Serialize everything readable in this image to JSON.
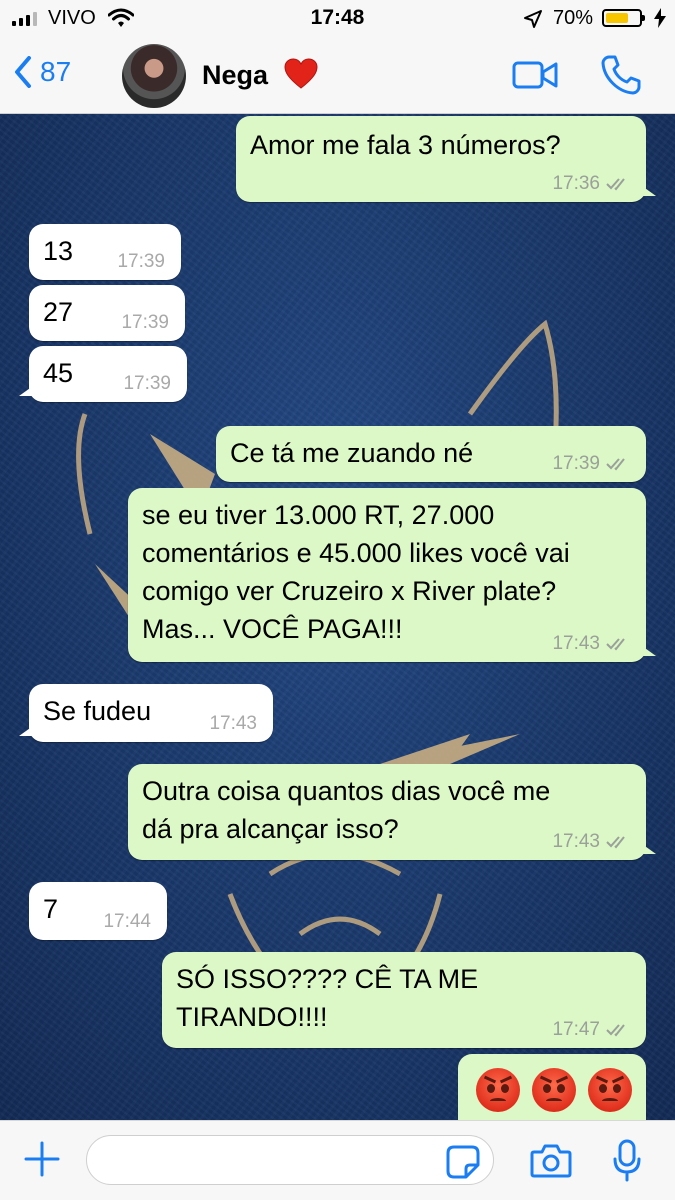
{
  "status_bar": {
    "carrier": "VIVO",
    "time": "17:48",
    "battery_percent": "70%",
    "battery_level": 0.7,
    "battery_color": "#f7c600"
  },
  "header": {
    "back_count": "87",
    "contact_name": "Nega",
    "contact_emoji": "red-heart-icon",
    "accent_color": "#1a7ef2"
  },
  "messages": [
    {
      "direction": "out",
      "text": "Amor me fala 3 números?",
      "time": "17:36",
      "read": true
    },
    {
      "direction": "in",
      "text": "13",
      "time": "17:39"
    },
    {
      "direction": "in",
      "text": "27",
      "time": "17:39"
    },
    {
      "direction": "in",
      "text": "45",
      "time": "17:39"
    },
    {
      "direction": "out",
      "text": "Ce tá me zuando né",
      "time": "17:39",
      "read": true
    },
    {
      "direction": "out",
      "lines": [
        "se eu tiver 13.000 RT, 27.000",
        "comentários e 45.000 likes você vai",
        "comigo ver Cruzeiro x River plate?",
        "Mas... VOCÊ PAGA!!!"
      ],
      "time": "17:43",
      "read": true
    },
    {
      "direction": "in",
      "text": "Se fudeu",
      "time": "17:43"
    },
    {
      "direction": "out",
      "lines": [
        "Outra coisa quantos dias você me",
        "dá pra alcançar isso?"
      ],
      "time": "17:43",
      "read": true
    },
    {
      "direction": "in",
      "text": "7",
      "time": "17:44"
    },
    {
      "direction": "out",
      "lines": [
        "SÓ ISSO???? CÊ TA ME",
        "TIRANDO!!!!"
      ],
      "time": "17:47",
      "read": true
    },
    {
      "direction": "out",
      "emoji": [
        "pouting-face-icon",
        "pouting-face-icon",
        "pouting-face-icon"
      ]
    }
  ],
  "input": {
    "placeholder": ""
  },
  "colors": {
    "outgoing_bubble": "#dcf8c6",
    "incoming_bubble": "#ffffff",
    "wallpaper": "#1b3a6e"
  }
}
